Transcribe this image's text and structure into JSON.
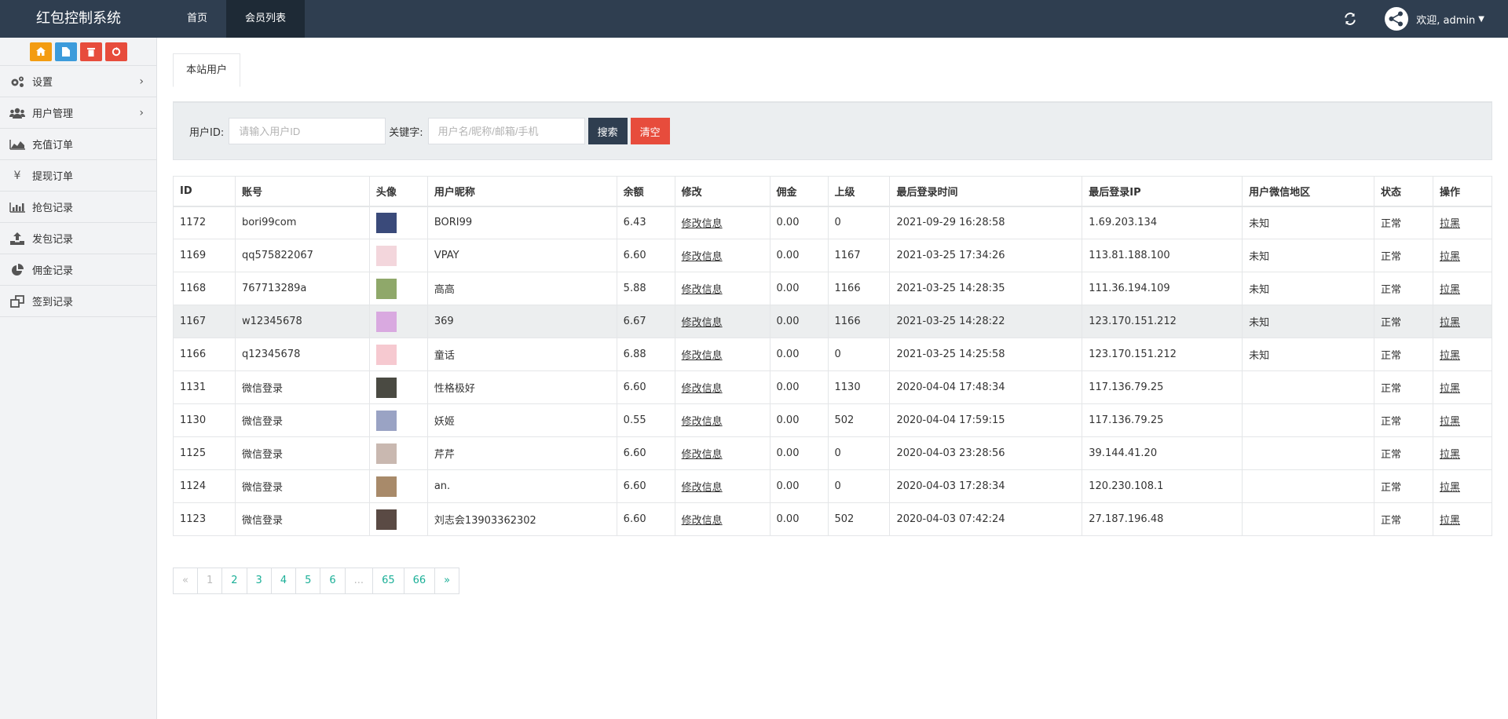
{
  "app": {
    "title": "红包控制系统"
  },
  "nav": {
    "tabs": [
      {
        "label": "首页"
      },
      {
        "label": "会员列表"
      }
    ]
  },
  "user": {
    "welcome": "欢迎, admin"
  },
  "sidebar": {
    "items": [
      {
        "label": "设置"
      },
      {
        "label": "用户管理"
      },
      {
        "label": "充值订单"
      },
      {
        "label": "提现订单"
      },
      {
        "label": "抢包记录"
      },
      {
        "label": "发包记录"
      },
      {
        "label": "佣金记录"
      },
      {
        "label": "签到记录"
      }
    ]
  },
  "page": {
    "tab": "本站用户"
  },
  "search": {
    "uid_label": "用户ID:",
    "uid_placeholder": "请输入用户ID",
    "kw_label": "关键字:",
    "kw_placeholder": "用户名/昵称/邮箱/手机",
    "search_btn": "搜索",
    "clear_btn": "清空"
  },
  "table": {
    "headers": [
      "ID",
      "账号",
      "头像",
      "用户昵称",
      "余额",
      "修改",
      "佣金",
      "上级",
      "最后登录时间",
      "最后登录IP",
      "用户微信地区",
      "状态",
      "操作"
    ],
    "rows": [
      {
        "id": "1172",
        "account": "bori99com",
        "avatar": "#3a4a7a",
        "nickname": "BORI99",
        "balance": "6.43",
        "edit": "修改信息",
        "commission": "0.00",
        "parent": "0",
        "last_login": "2021-09-29 16:28:58",
        "ip": "1.69.203.134",
        "region": "未知",
        "status": "正常",
        "action": "拉黑"
      },
      {
        "id": "1169",
        "account": "qq575822067",
        "avatar": "#f3d6dc",
        "nickname": "VPAY",
        "balance": "6.60",
        "edit": "修改信息",
        "commission": "0.00",
        "parent": "1167",
        "last_login": "2021-03-25 17:34:26",
        "ip": "113.81.188.100",
        "region": "未知",
        "status": "正常",
        "action": "拉黑"
      },
      {
        "id": "1168",
        "account": "767713289a",
        "avatar": "#8fa86a",
        "nickname": "高高",
        "balance": "5.88",
        "edit": "修改信息",
        "commission": "0.00",
        "parent": "1166",
        "last_login": "2021-03-25 14:28:35",
        "ip": "111.36.194.109",
        "region": "未知",
        "status": "正常",
        "action": "拉黑"
      },
      {
        "id": "1167",
        "account": "w12345678",
        "avatar": "#d9a9e0",
        "nickname": "369",
        "balance": "6.67",
        "edit": "修改信息",
        "commission": "0.00",
        "parent": "1166",
        "last_login": "2021-03-25 14:28:22",
        "ip": "123.170.151.212",
        "region": "未知",
        "status": "正常",
        "action": "拉黑"
      },
      {
        "id": "1166",
        "account": "q12345678",
        "avatar": "#f6c9d0",
        "nickname": "童话",
        "balance": "6.88",
        "edit": "修改信息",
        "commission": "0.00",
        "parent": "0",
        "last_login": "2021-03-25 14:25:58",
        "ip": "123.170.151.212",
        "region": "未知",
        "status": "正常",
        "action": "拉黑"
      },
      {
        "id": "1131",
        "account": "微信登录",
        "avatar": "#4a4a42",
        "nickname": "性格极好",
        "balance": "6.60",
        "edit": "修改信息",
        "commission": "0.00",
        "parent": "1130",
        "last_login": "2020-04-04 17:48:34",
        "ip": "117.136.79.25",
        "region": "",
        "status": "正常",
        "action": "拉黑"
      },
      {
        "id": "1130",
        "account": "微信登录",
        "avatar": "#9aa3c4",
        "nickname": "妖姬",
        "balance": "0.55",
        "edit": "修改信息",
        "commission": "0.00",
        "parent": "502",
        "last_login": "2020-04-04 17:59:15",
        "ip": "117.136.79.25",
        "region": "",
        "status": "正常",
        "action": "拉黑"
      },
      {
        "id": "1125",
        "account": "微信登录",
        "avatar": "#c9b8b0",
        "nickname": "芹芹",
        "balance": "6.60",
        "edit": "修改信息",
        "commission": "0.00",
        "parent": "0",
        "last_login": "2020-04-03 23:28:56",
        "ip": "39.144.41.20",
        "region": "",
        "status": "正常",
        "action": "拉黑"
      },
      {
        "id": "1124",
        "account": "微信登录",
        "avatar": "#a88a6a",
        "nickname": "an.",
        "balance": "6.60",
        "edit": "修改信息",
        "commission": "0.00",
        "parent": "0",
        "last_login": "2020-04-03 17:28:34",
        "ip": "120.230.108.1",
        "region": "",
        "status": "正常",
        "action": "拉黑"
      },
      {
        "id": "1123",
        "account": "微信登录",
        "avatar": "#5a4a44",
        "nickname": "刘志会13903362302",
        "balance": "6.60",
        "edit": "修改信息",
        "commission": "0.00",
        "parent": "502",
        "last_login": "2020-04-03 07:42:24",
        "ip": "27.187.196.48",
        "region": "",
        "status": "正常",
        "action": "拉黑"
      }
    ]
  },
  "pagination": [
    "«",
    "1",
    "2",
    "3",
    "4",
    "5",
    "6",
    "...",
    "65",
    "66",
    "»"
  ],
  "colors": {
    "navbar": "#2f3e50",
    "accent_red": "#e74c3c",
    "link_green": "#1aaf97"
  }
}
